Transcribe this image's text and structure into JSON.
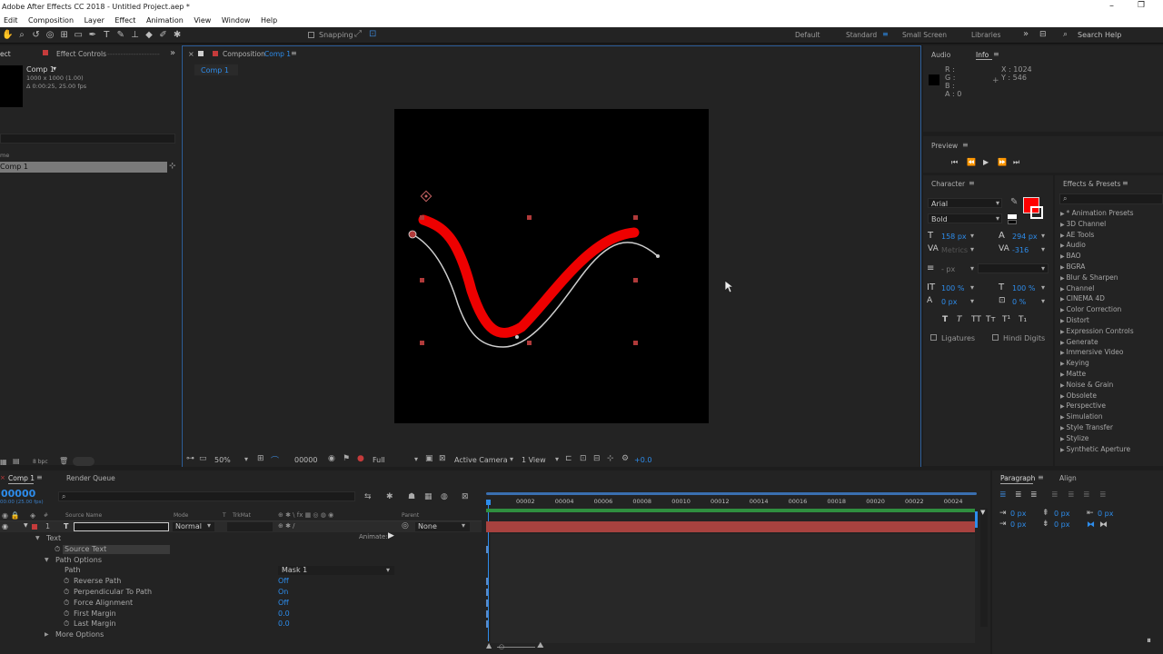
{
  "app": {
    "title": "Adobe After Effects CC 2018 - Untitled Project.aep *"
  },
  "menu": [
    "Edit",
    "Composition",
    "Layer",
    "Effect",
    "Animation",
    "View",
    "Window",
    "Help"
  ],
  "toolbar": {
    "snapping_label": "Snapping",
    "workspaces": [
      "Default",
      "Standard",
      "Small Screen",
      "Libraries"
    ],
    "active_workspace": "Standard",
    "search_placeholder": "Search Help"
  },
  "project_panel": {
    "tab_effect": "ect",
    "tab_effect_controls": "Effect Controls",
    "comp_name": "Comp 1",
    "comp_info_1": "1000 x 1000 (1.00)",
    "comp_info_2": "Δ 0:00:25, 25.00 fps",
    "col_name": "me",
    "item_label": "Comp 1",
    "bpc": "8 bpc"
  },
  "composition_panel": {
    "tab_prefix": "Composition",
    "tab_comp": "Comp 1",
    "subtab": "Comp 1",
    "zoom": "50%",
    "timecode": "00000",
    "resolution": "Full",
    "camera": "Active Camera",
    "views": "1 View",
    "exposure": "+0.0"
  },
  "info_panel": {
    "tab_audio": "Audio",
    "tab_info": "Info",
    "r": "R :",
    "g": "G :",
    "b": "B :",
    "a": "A : 0",
    "x": "X : 1024",
    "y": "Y : 546"
  },
  "preview_panel": {
    "title": "Preview"
  },
  "character_panel": {
    "title": "Character",
    "font": "Arial",
    "style": "Bold",
    "font_size": "158 px",
    "leading": "294 px",
    "kerning": "Metrics",
    "tracking": "-316",
    "stroke_width": "- px",
    "vscale": "100 %",
    "hscale": "100 %",
    "baseline": "0 px",
    "tsume": "0 %",
    "style_buttons": [
      "T",
      "T",
      "TT",
      "Tт",
      "T¹",
      "T₁"
    ],
    "ligatures": "Ligatures",
    "hindi_digits": "Hindi Digits",
    "fill_color": "#ff0000"
  },
  "effects_presets": {
    "title": "Effects & Presets",
    "items": [
      "* Animation Presets",
      "3D Channel",
      "AE Tools",
      "Audio",
      "BAO",
      "BGRA",
      "Blur & Sharpen",
      "Channel",
      "CINEMA 4D",
      "Color Correction",
      "Distort",
      "Expression Controls",
      "Generate",
      "Immersive Video",
      "Keying",
      "Matte",
      "Noise & Grain",
      "Obsolete",
      "Perspective",
      "Simulation",
      "Style Transfer",
      "Stylize",
      "Synthetic Aperture"
    ]
  },
  "timeline": {
    "tab_comp": "Comp 1",
    "tab_render": "Render Queue",
    "timecode": "00000",
    "timecode_sub": "00:00 (25.00 fps)",
    "col_source": "Source Name",
    "col_mode": "Mode",
    "col_t": "T",
    "col_trkmat": "TrkMat",
    "col_parent": "Parent",
    "layer_num": "1",
    "layer_mode": "Normal",
    "layer_parent": "None",
    "animate_label": "Animate:",
    "ticks": [
      "00002",
      "00004",
      "00006",
      "00008",
      "00010",
      "00012",
      "00014",
      "00016",
      "00018",
      "00020",
      "00022",
      "00024"
    ],
    "props": [
      {
        "name": "Text",
        "value": "",
        "indent": 1
      },
      {
        "name": "Source Text",
        "value": "",
        "indent": 3
      },
      {
        "name": "Path Options",
        "value": "",
        "indent": 2
      },
      {
        "name": "Path",
        "value": "Mask 1",
        "indent": 3
      },
      {
        "name": "Reverse Path",
        "value": "Off",
        "indent": 4
      },
      {
        "name": "Perpendicular To Path",
        "value": "On",
        "indent": 4
      },
      {
        "name": "Force Alignment",
        "value": "Off",
        "indent": 4
      },
      {
        "name": "First Margin",
        "value": "0.0",
        "indent": 4
      },
      {
        "name": "Last Margin",
        "value": "0.0",
        "indent": 4
      },
      {
        "name": "More Options",
        "value": "",
        "indent": 2
      }
    ]
  },
  "paragraph_panel": {
    "tab_paragraph": "Paragraph",
    "tab_align": "Align",
    "val1": "0 px",
    "val2": "0 px",
    "val3": "0 px",
    "val4": "0 px",
    "val5": "0 px"
  }
}
